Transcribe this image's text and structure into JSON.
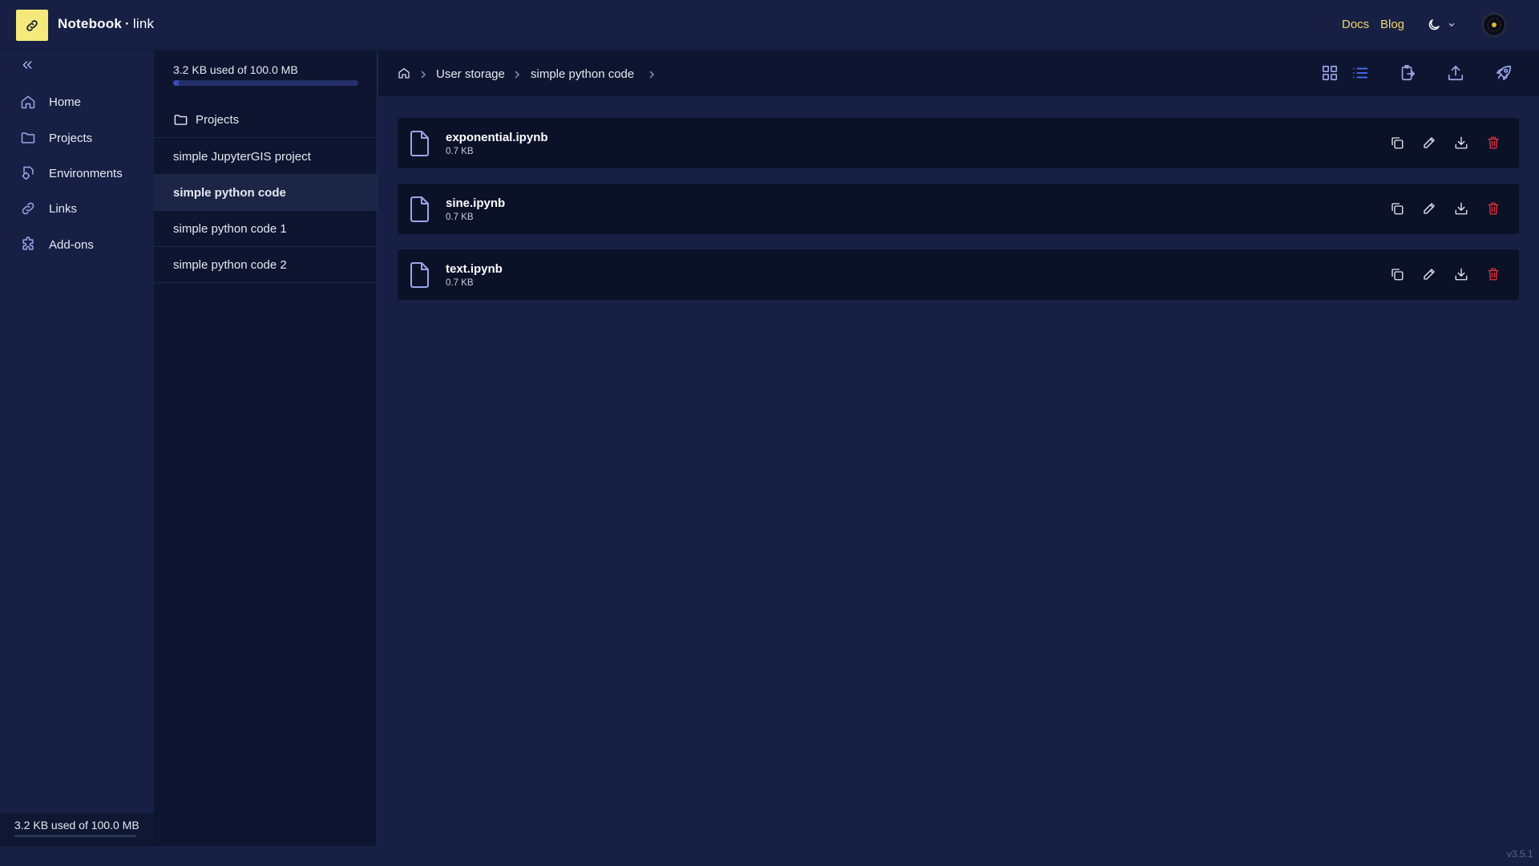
{
  "header": {
    "brand_name": "Notebook",
    "brand_separator": "·",
    "brand_suffix": "link",
    "docs_label": "Docs",
    "blog_label": "Blog"
  },
  "sidebar": {
    "items": [
      {
        "label": "Home",
        "icon": "home-icon"
      },
      {
        "label": "Projects",
        "icon": "folder-icon"
      },
      {
        "label": "Environments",
        "icon": "environments-icon"
      },
      {
        "label": "Links",
        "icon": "link-icon"
      },
      {
        "label": "Add-ons",
        "icon": "puzzle-icon"
      }
    ],
    "storage_text": "3.2 KB used of 100.0 MB"
  },
  "projects": {
    "usage_text": "3.2 KB used of 100.0 MB",
    "usage_fraction": 0.032,
    "header_label": "Projects",
    "items": [
      {
        "label": "simple JupyterGIS project"
      },
      {
        "label": "simple python code"
      },
      {
        "label": "simple python code 1"
      },
      {
        "label": "simple python code 2"
      }
    ],
    "active": "simple python code"
  },
  "breadcrumb": {
    "items": [
      "User storage",
      "simple python code"
    ]
  },
  "files": [
    {
      "name": "exponential.ipynb",
      "size": "0.7 KB"
    },
    {
      "name": "sine.ipynb",
      "size": "0.7 KB"
    },
    {
      "name": "text.ipynb",
      "size": "0.7 KB"
    }
  ],
  "colors": {
    "accent": "#f4e97a",
    "link": "#f0d76b",
    "icon": "#9aa6e8",
    "list_view_active": "#4d6dff",
    "danger": "#e5303a"
  },
  "version": "v3.5.1"
}
